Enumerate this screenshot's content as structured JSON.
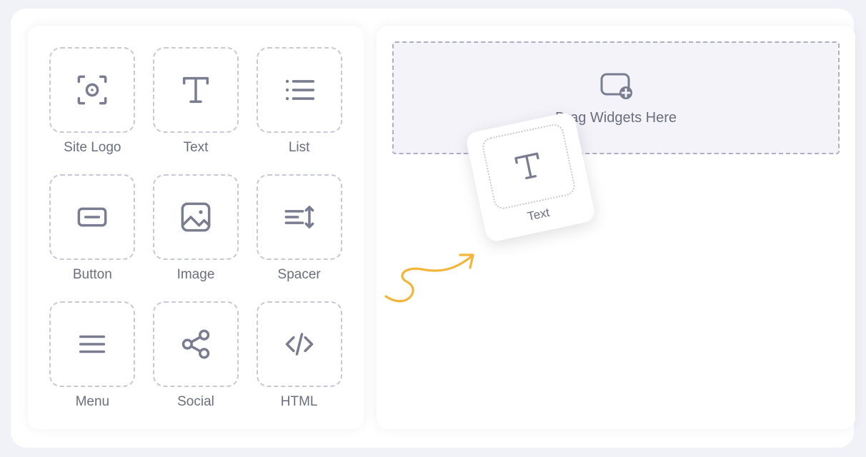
{
  "widgets": [
    {
      "id": "site-logo",
      "label": "Site Logo"
    },
    {
      "id": "text",
      "label": "Text"
    },
    {
      "id": "list",
      "label": "List"
    },
    {
      "id": "button",
      "label": "Button"
    },
    {
      "id": "image",
      "label": "Image"
    },
    {
      "id": "spacer",
      "label": "Spacer"
    },
    {
      "id": "menu",
      "label": "Menu"
    },
    {
      "id": "social",
      "label": "Social"
    },
    {
      "id": "html",
      "label": "HTML"
    }
  ],
  "drop_zone": {
    "text": "Drag Widgets Here"
  },
  "dragging": {
    "label": "Text"
  },
  "colors": {
    "icon": "#7A7D8F",
    "accent": "#F2B63A"
  }
}
